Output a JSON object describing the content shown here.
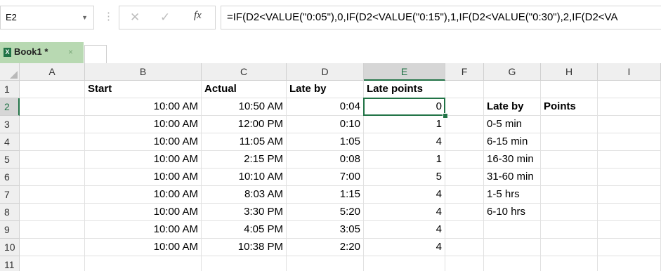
{
  "formula_bar": {
    "name_box": "E2",
    "cancel_icon": "✕",
    "enter_icon": "✓",
    "fx_label": "fx",
    "formula": "=IF(D2<VALUE(\"0:05\"),0,IF(D2<VALUE(\"0:15\"),1,IF(D2<VALUE(\"0:30\"),2,IF(D2<VA"
  },
  "workbook_tab": {
    "label": "Book1 *",
    "close_icon": "×",
    "icon_name": "excel-workbook-icon"
  },
  "columns": [
    "A",
    "B",
    "C",
    "D",
    "E",
    "F",
    "G",
    "H",
    "I"
  ],
  "selected": {
    "column": "E",
    "row": "2"
  },
  "rows": [
    {
      "n": "1",
      "A": "",
      "B": "Start",
      "C": "Actual",
      "D": "Late by",
      "E": "Late points",
      "F": "",
      "G": "",
      "H": "",
      "I": ""
    },
    {
      "n": "2",
      "A": "",
      "B": "10:00 AM",
      "C": "10:50 AM",
      "D": "0:04",
      "E": "0",
      "F": "",
      "G": "Late by",
      "H": "Points",
      "I": ""
    },
    {
      "n": "3",
      "A": "",
      "B": "10:00 AM",
      "C": "12:00 PM",
      "D": "0:10",
      "E": "1",
      "F": "",
      "G": "0-5 min",
      "H": "",
      "I": ""
    },
    {
      "n": "4",
      "A": "",
      "B": "10:00 AM",
      "C": "11:05 AM",
      "D": "1:05",
      "E": "4",
      "F": "",
      "G": "6-15 min",
      "H": "",
      "I": ""
    },
    {
      "n": "5",
      "A": "",
      "B": "10:00 AM",
      "C": "2:15 PM",
      "D": "0:08",
      "E": "1",
      "F": "",
      "G": "16-30 min",
      "H": "",
      "I": ""
    },
    {
      "n": "6",
      "A": "",
      "B": "10:00 AM",
      "C": "10:10 AM",
      "D": "7:00",
      "E": "5",
      "F": "",
      "G": "31-60 min",
      "H": "",
      "I": ""
    },
    {
      "n": "7",
      "A": "",
      "B": "10:00 AM",
      "C": "8:03 AM",
      "D": "1:15",
      "E": "4",
      "F": "",
      "G": "1-5 hrs",
      "H": "",
      "I": ""
    },
    {
      "n": "8",
      "A": "",
      "B": "10:00 AM",
      "C": "3:30 PM",
      "D": "5:20",
      "E": "4",
      "F": "",
      "G": "6-10 hrs",
      "H": "",
      "I": ""
    },
    {
      "n": "9",
      "A": "",
      "B": "10:00 AM",
      "C": "4:05 PM",
      "D": "3:05",
      "E": "4",
      "F": "",
      "G": "",
      "H": "",
      "I": ""
    },
    {
      "n": "10",
      "A": "",
      "B": "10:00 AM",
      "C": "10:38 PM",
      "D": "2:20",
      "E": "4",
      "F": "",
      "G": "",
      "H": "",
      "I": ""
    },
    {
      "n": "11",
      "A": "",
      "B": "",
      "C": "",
      "D": "",
      "E": "",
      "F": "",
      "G": "",
      "H": "",
      "I": ""
    }
  ],
  "bold_cells": [
    "B1",
    "C1",
    "D1",
    "E1",
    "G2",
    "H2"
  ],
  "colors": {
    "accent": "#217346",
    "tab_bg": "#b8d9b2",
    "header_bg": "#efefef"
  }
}
